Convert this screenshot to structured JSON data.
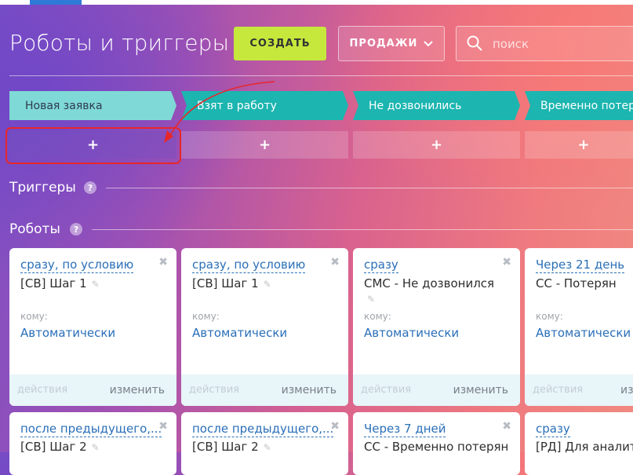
{
  "header": {
    "title": "Роботы и триггеры",
    "create_label": "СОЗДАТЬ",
    "pipeline_label": "ПРОДАЖИ",
    "search_placeholder": "поиск"
  },
  "stages": [
    {
      "label": "Новая заявка"
    },
    {
      "label": "Взят в работу"
    },
    {
      "label": "Не дозвонились"
    },
    {
      "label": "Временно потерян"
    }
  ],
  "add_symbol": "+",
  "sections": {
    "triggers": "Триггеры",
    "robots": "Роботы",
    "help_symbol": "?"
  },
  "robots_row1": [
    {
      "condition": "сразу, по условию",
      "name": "[СВ] Шаг 1",
      "to_label": "кому:",
      "to_value": "Автоматически",
      "actions": "действия",
      "edit": "изменить"
    },
    {
      "condition": "сразу, по условию",
      "name": "[СВ] Шаг 1",
      "to_label": "кому:",
      "to_value": "Автоматически",
      "actions": "действия",
      "edit": "изменить"
    },
    {
      "condition": "сразу",
      "name": "СМС - Не дозвонился",
      "to_label": "кому:",
      "to_value": "Автоматически",
      "actions": "действия",
      "edit": "изменить"
    },
    {
      "condition": "Через 21 день",
      "name": "СС - Потерян",
      "to_label": "кому:",
      "to_value": "Автоматически",
      "actions": "действия",
      "edit": "изменить"
    }
  ],
  "robots_row2": [
    {
      "condition": "после предыдущего,...",
      "name": "[СВ] Шаг 2"
    },
    {
      "condition": "после предыдущего,...",
      "name": "[СВ] Шаг 2"
    },
    {
      "condition": "Через 7 дней",
      "name": "СС - Временно потерян"
    },
    {
      "condition": "сразу",
      "name": "[РД] Для аналитики"
    }
  ],
  "colors": {
    "create_button": "#c6e83c",
    "stage_first": "#7fd9d6",
    "stage": "#1cb5b0",
    "link": "#2a6fb8",
    "highlight": "#e8262a"
  }
}
